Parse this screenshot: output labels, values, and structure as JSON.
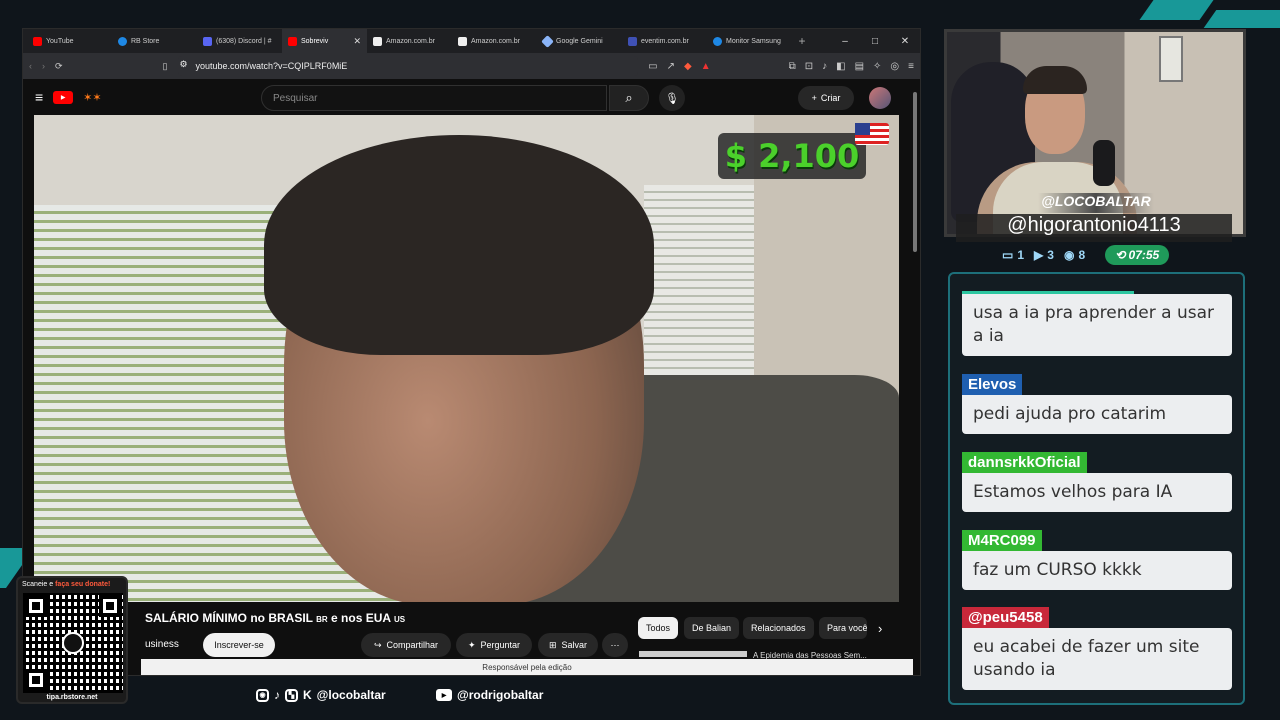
{
  "browser": {
    "tabs": [
      {
        "label": "YouTube",
        "color": "#ff0000"
      },
      {
        "label": "RB Store",
        "color": "#1e88e5"
      },
      {
        "label": "(6308) Discord | #",
        "color": "#5865f2"
      },
      {
        "label": "Sobreviv",
        "color": "#ff0000",
        "active": true
      },
      {
        "label": "Amazon.com.br",
        "color": "#eeeeee"
      },
      {
        "label": "Amazon.com.br",
        "color": "#eeeeee"
      },
      {
        "label": "Google Gemini",
        "color": "#8ab4f8"
      },
      {
        "label": "eventim.com.br",
        "color": "#3f51b5"
      },
      {
        "label": "Monitor Samsung",
        "color": "#1e88e5"
      }
    ],
    "new_tab_symbol": "+",
    "url": "youtube.com/watch?v=CQIPLRF0MiE",
    "window_controls": [
      "–",
      "□",
      "✕"
    ]
  },
  "youtube": {
    "search_placeholder": "Pesquisar",
    "create_label": "Criar",
    "money_overlay": "$ 2,100",
    "video_title_main": "SALÁRIO MÍNIMO no BRASIL",
    "video_title_br": "BR",
    "video_title_mid": "e nos EUA",
    "video_title_us": "US",
    "channel_fragment": "usiness",
    "subscribe_label": "Inscrever-se",
    "share_label": "Compartilhar",
    "ask_label": "Perguntar",
    "save_label": "Salvar",
    "more_label": "⋯",
    "chips": [
      "Todos",
      "De Balian",
      "Relacionados",
      "Para você"
    ],
    "side_video_title": "A Epidemia das Pessoas Sem...",
    "edit_banner": "Responsável pela edição"
  },
  "qr": {
    "top_text": "Scaneie e",
    "top_highlight": "faça seu donate!",
    "bottom_text": "tipa.rbstore.net"
  },
  "socials": {
    "handle": "@locobaltar",
    "youtube_handle": "@rodrigobaltar"
  },
  "cam": {
    "tag": "@LOCOBALTAR",
    "handle": "@higorantonio4113",
    "stats": [
      {
        "icon": "chat-icon",
        "value": "1"
      },
      {
        "icon": "video-icon",
        "value": "3"
      },
      {
        "icon": "eye-icon",
        "value": "8"
      }
    ],
    "timer": "07:55"
  },
  "chat": {
    "messages": [
      {
        "user": "",
        "user_color": "",
        "text": "usa a ia pra aprender a usar a ia"
      },
      {
        "user": "Elevos",
        "user_color": "#1f5fb0",
        "text": "pedi ajuda pro catarim"
      },
      {
        "user": "dannsrkkOficial",
        "user_color": "#33b833",
        "text": "Estamos velhos para IA"
      },
      {
        "user": "M4RC099",
        "user_color": "#33b833",
        "text": "faz um CURSO kkkk"
      },
      {
        "user": "@peu5458",
        "user_color": "#c8283a",
        "text": "eu acabei de fazer um site usando ia"
      }
    ]
  },
  "colors": {
    "accent_teal": "#1aa6a6",
    "youtube_red": "#ff0000",
    "money_green": "#4bd12b",
    "timer_green": "#1f9a5a"
  }
}
